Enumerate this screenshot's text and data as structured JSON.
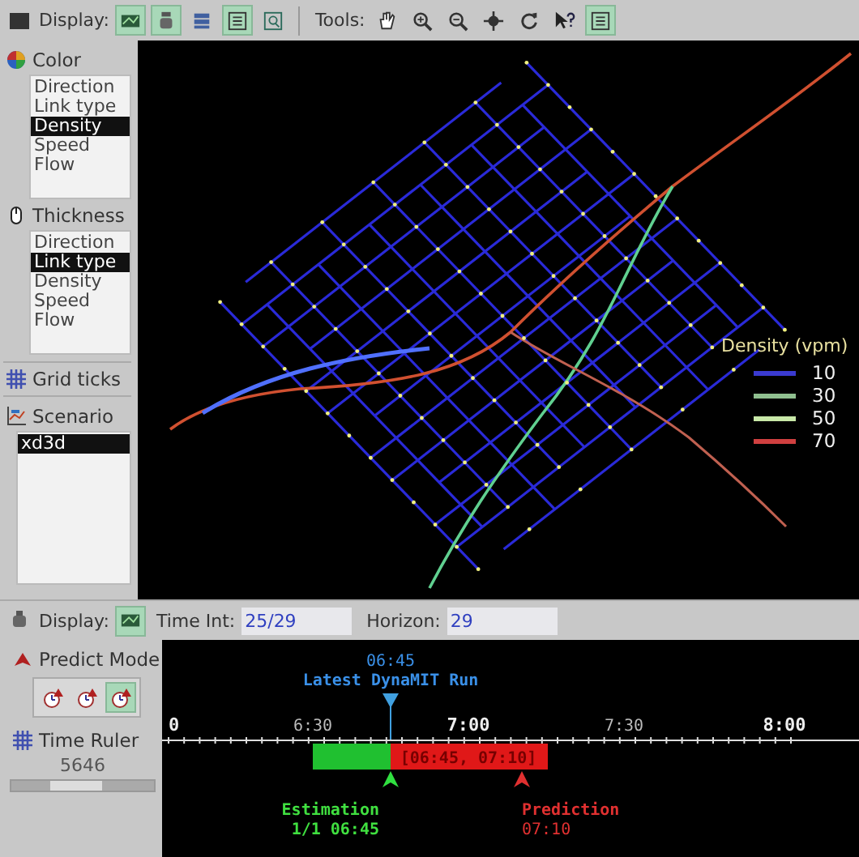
{
  "toolbar": {
    "display_label": "Display:",
    "display_buttons": [
      {
        "kind": "map",
        "selected": true
      },
      {
        "kind": "device",
        "selected": true
      },
      {
        "kind": "stack",
        "selected": false
      },
      {
        "kind": "list",
        "selected": true
      },
      {
        "kind": "zoom-window",
        "selected": false
      }
    ],
    "tools_label": "Tools:",
    "tools": [
      {
        "kind": "hand",
        "selected": false
      },
      {
        "kind": "zoom-in",
        "selected": false
      },
      {
        "kind": "zoom-out",
        "selected": false
      },
      {
        "kind": "crosshair",
        "selected": false
      },
      {
        "kind": "rotate",
        "selected": false
      },
      {
        "kind": "help",
        "selected": false
      },
      {
        "kind": "list",
        "selected": true
      }
    ]
  },
  "color_panel": {
    "title": "Color",
    "options": [
      {
        "label": "Direction",
        "selected": false
      },
      {
        "label": "Link type",
        "selected": false
      },
      {
        "label": "Density",
        "selected": true
      },
      {
        "label": "Speed",
        "selected": false
      },
      {
        "label": "Flow",
        "selected": false
      }
    ]
  },
  "thickness_panel": {
    "title": "Thickness",
    "options": [
      {
        "label": "Direction",
        "selected": false
      },
      {
        "label": "Link type",
        "selected": true
      },
      {
        "label": "Density",
        "selected": false
      },
      {
        "label": "Speed",
        "selected": false
      },
      {
        "label": "Flow",
        "selected": false
      }
    ]
  },
  "grid_ticks": {
    "label": "Grid ticks"
  },
  "scenario_panel": {
    "title": "Scenario",
    "items": [
      {
        "label": "xd3d",
        "selected": true
      }
    ]
  },
  "map": {
    "legend": {
      "title": "Density (vpm)",
      "items": [
        {
          "label": "10",
          "color": "#3a3ad0"
        },
        {
          "label": "30",
          "color": "#8fbf8f"
        },
        {
          "label": "50",
          "color": "#c8e8a8"
        },
        {
          "label": "70",
          "color": "#d04040"
        }
      ]
    }
  },
  "bottom_toolbar": {
    "display_label": "Display:",
    "display_button": {
      "kind": "map",
      "selected": true
    },
    "time_int_label": "Time Int:",
    "time_int_value": "25/29",
    "horizon_label": "Horizon:",
    "horizon_value": "29"
  },
  "predict_mode": {
    "title": "Predict Mode",
    "buttons": [
      {
        "selected": false
      },
      {
        "selected": false
      },
      {
        "selected": true
      }
    ]
  },
  "time_ruler": {
    "title": "Time Ruler",
    "value": "5646",
    "level": 0.45
  },
  "timeline": {
    "latest_run_time": "06:45",
    "latest_run_label": "Latest DynaMIT Run",
    "ticks": [
      {
        "label": "0",
        "major": true
      },
      {
        "label": "6:30",
        "major": false
      },
      {
        "label": "7:00",
        "major": true
      },
      {
        "label": "7:30",
        "major": false
      },
      {
        "label": "8:00",
        "major": true
      }
    ],
    "interval": "[06:45, 07:10]",
    "estimation_label": "Estimation",
    "estimation_detail": "1/1  06:45",
    "prediction_label": "Prediction",
    "prediction_time": "07:10"
  }
}
